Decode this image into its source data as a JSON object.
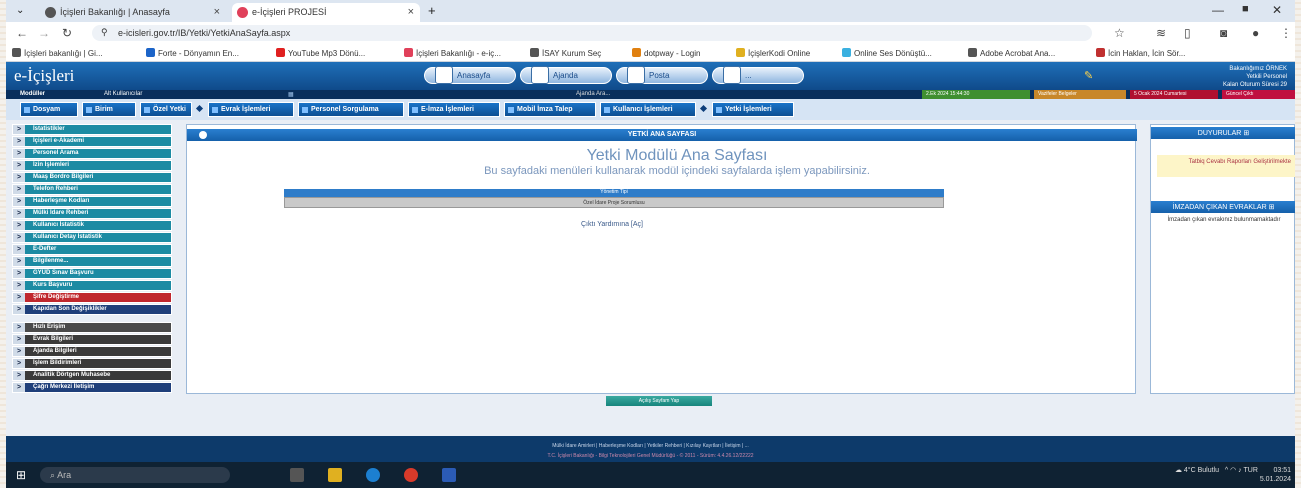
{
  "browser": {
    "tabs": [
      {
        "label": "İçişleri Bakanlığı | Anasayfa",
        "active": false
      },
      {
        "label": "e-İçişleri PROJESİ",
        "active": true
      }
    ],
    "url": "e-icisleri.gov.tr/IB/Yetki/YetkiAnaSayfa.aspx",
    "bookmarks": [
      "İçişleri bakanlığı | Gi...",
      "Forte - Dönyamın En...",
      "YouTube Mp3 Dönü...",
      "İçişleri Bakanlığı - e-iç...",
      "İSAY Kurum Seç",
      "dotpway - Login",
      "İçişlerKodi Online",
      "Online Ses Dönüştü...",
      "Adobe Acrobat Ana...",
      "İcin Haklan, İcin Sör..."
    ]
  },
  "app": {
    "logo": "e-İçişleri",
    "header_buttons": [
      "Anasayfa",
      "Ajanda",
      "Posta",
      "..."
    ],
    "module_label": "Modüller",
    "module_value": "Alt Kullanıcılar",
    "search_placeholder": "Ajanda Ara...",
    "user_info": [
      "Bakanlığımız ÖRNEK",
      "Yetkili Personel",
      "Kalan Oturum Süresi 29"
    ],
    "status_pills": [
      "2.Ek 2024 15:44:30",
      "Vazifeler Belgeler",
      "5 Ocak 2024 Cumartesi",
      "Güncel Çıktı"
    ],
    "menu": [
      "Dosyam",
      "Birim",
      "Özel Yetki",
      "Evrak İşlemleri",
      "Personel Sorgulama",
      "E-İmza İşlemleri",
      "Mobil İmza Talep",
      "Kullanıcı İşlemleri",
      "Yetki İşlemleri"
    ],
    "sidebar_group1": [
      {
        "label": "İstatistikler",
        "color": "#1c8ba3"
      },
      {
        "label": "İçişleri e-Akademi",
        "color": "#1c8ba3"
      },
      {
        "label": "Personel Arama",
        "color": "#1c8ba3"
      },
      {
        "label": "İzin İşlemleri",
        "color": "#1c8ba3"
      },
      {
        "label": "Maaş Bordro Bilgileri",
        "color": "#1c8ba3"
      },
      {
        "label": "Telefon Rehberi",
        "color": "#1c8ba3"
      },
      {
        "label": "Haberleşme Kodları",
        "color": "#1c8ba3"
      },
      {
        "label": "Mülki İdare Rehberi",
        "color": "#1c8ba3"
      },
      {
        "label": "Kullanıcı İstatistik",
        "color": "#1c8ba3"
      },
      {
        "label": "Kullanıcı Detay İstatistik",
        "color": "#1c8ba3"
      },
      {
        "label": "E-Defter",
        "color": "#1c8ba3"
      },
      {
        "label": "Bilgilenme...",
        "color": "#1c8ba3"
      },
      {
        "label": "GYÜD Sınav Başvuru",
        "color": "#1c8ba3"
      },
      {
        "label": "Kurs Başvuru",
        "color": "#1c8ba3"
      },
      {
        "label": "Şifre Değiştirme",
        "color": "#c0272d"
      },
      {
        "label": "Kapıdan Son Değişiklikler",
        "color": "#1f3f7a"
      }
    ],
    "sidebar_group2": [
      {
        "label": "Hızlı Erişim",
        "color": "#4a4a4a"
      },
      {
        "label": "Evrak Bilgileri",
        "color": "#3a3a3a"
      },
      {
        "label": "Ajanda Bilgileri",
        "color": "#3a3a3a"
      },
      {
        "label": "İşlem Bildirimleri",
        "color": "#3a3a3a"
      },
      {
        "label": "Analitik Dörtgen Muhasebe",
        "color": "#3a3a3a"
      },
      {
        "label": "Çağrı Merkezi İletişim",
        "color": "#1f3f7a"
      }
    ],
    "main": {
      "header": "YETKİ ANA SAYFASI",
      "title": "Yetki Modülü Ana Sayfası",
      "subtitle": "Bu sayfadaki menüleri kullanarak modül içindeki sayfalarda işlem yapabilirsiniz.",
      "table_header": "Yönetim Tipi",
      "table_row": "Özel İdare Proje Sorumlusu",
      "link": "Çıktı Yardımına [Aç]"
    },
    "right": {
      "duyurular_title": "DUYURULAR",
      "duyuru_text": "Tatbiq Cevabı Raporları Geliştirilmekte",
      "panel2_title": "İMZADAN ÇIKAN EVRAKLAR",
      "panel2_text": "İmzadan çıkan evrakınız bulunmamaktadır"
    },
    "page_button": "Açılış Sayfam Yap",
    "footer_line1": "Mülki İdare Amirleri | Haberleşme Kodları | Yetkiler Rehberi | Kızılay Kayıtları | İletişim | ...",
    "footer_line2": "T.C. İçişleri Bakanlığı - Bilgi Teknolojileri Genel Müdürlüğü - © 2011 - Sürüm: 4.4.26.12/22222"
  },
  "taskbar": {
    "search_placeholder": "Ara",
    "weather": "4°C Bulutlu",
    "lang": "TUR",
    "time": "03:51",
    "date": "5.01.2024"
  }
}
